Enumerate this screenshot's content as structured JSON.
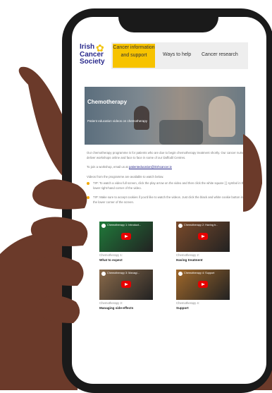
{
  "header": {
    "logo_text": "Irish\nCancer\nSociety",
    "nav": [
      {
        "label": "Cancer information and support",
        "active": true
      },
      {
        "label": "Ways to help",
        "active": false
      },
      {
        "label": "Cancer research",
        "active": false
      }
    ]
  },
  "hero": {
    "title": "Chemotherapy",
    "subtitle": "Patient education videos on chemotherapy"
  },
  "body": {
    "intro": "Our chemotherapy programme is for patients who are due to begin chemotherapy treatment shortly. Our cancer nurses deliver workshops online and face to face in some of our Daffodil Centres.",
    "join_prefix": "To join a workshop, email us at ",
    "join_email": "patienteducation@irishcancer.ie",
    "videos_intro": "Videos from the programme are available to watch below.",
    "tips": [
      "TIP: To watch a video full screen, click the play arrow on the video and then click the white square [ ] symbol in the lower right-hand corner of the video.",
      "TIP: Make sure to accept cookies if you'd like to watch the videos. Just click the black and white cookie button in the lower corner of the screen."
    ]
  },
  "videos": [
    {
      "thumb_title": "Chemotherapy 1: Introduct...",
      "label": "Chemotherapy 1:",
      "name": "What to expect",
      "color": "#1f7a3a"
    },
    {
      "thumb_title": "Chemotherapy 2: Having tr...",
      "label": "Chemotherapy 2:",
      "name": "Having treatment",
      "color": "#7a4a2a"
    },
    {
      "thumb_title": "Chemotherapy 3: Managi...",
      "label": "Chemotherapy 3:",
      "name": "Managing side-effects",
      "color": "#8a6a4a"
    },
    {
      "thumb_title": "Chemotherapy 4: Support",
      "label": "Chemotherapy 4:",
      "name": "Support",
      "color": "#a0682a"
    }
  ],
  "colors": {
    "brand_yellow": "#f7c300",
    "brand_navy": "#2a2a8c",
    "play_red": "#e60000",
    "skin": "#6b3a2a"
  }
}
